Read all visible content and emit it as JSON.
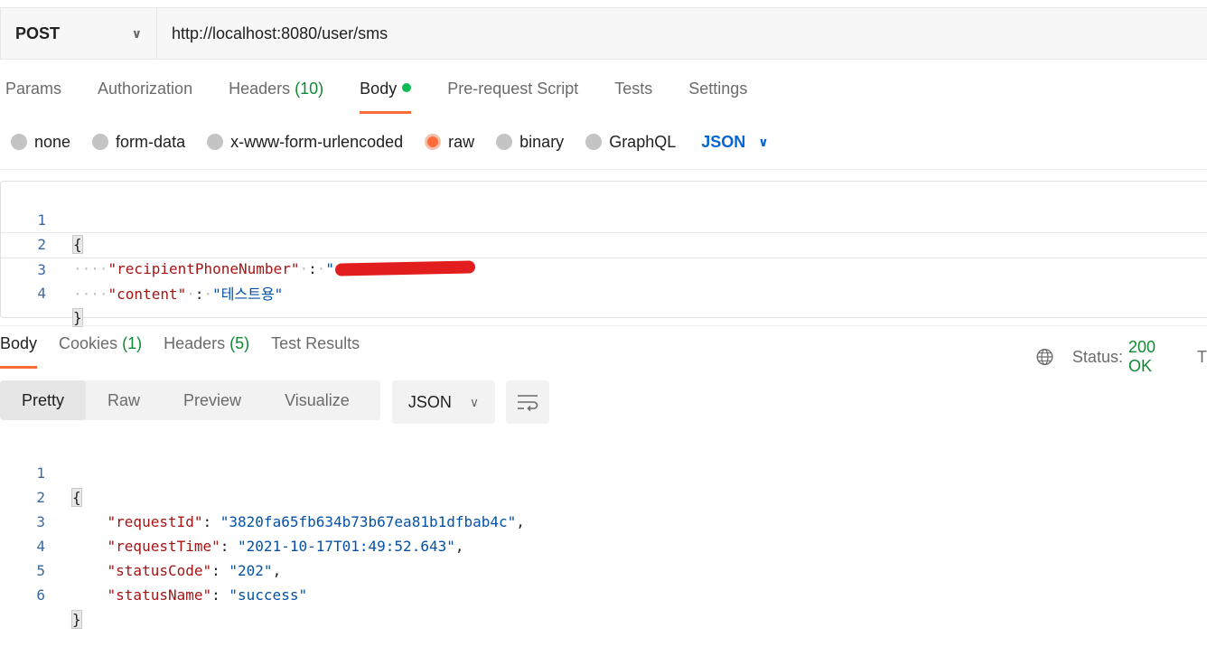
{
  "request": {
    "method": "POST",
    "url": "http://localhost:8080/user/sms"
  },
  "request_tabs": [
    {
      "label": "Params"
    },
    {
      "label": "Authorization"
    },
    {
      "label": "Headers",
      "count": "(10)"
    },
    {
      "label": "Body"
    },
    {
      "label": "Pre-request Script"
    },
    {
      "label": "Tests"
    },
    {
      "label": "Settings"
    }
  ],
  "body_types": [
    "none",
    "form-data",
    "x-www-form-urlencoded",
    "raw",
    "binary",
    "GraphQL"
  ],
  "body_format": "JSON",
  "request_body": {
    "line_numbers": [
      "1",
      "2",
      "3",
      "4"
    ],
    "open_brace": "{",
    "close_brace": "}",
    "key1": "\"recipientPhoneNumber\"",
    "key2": "\"content\"",
    "value2": "\"테스트용\"",
    "colon": ":"
  },
  "response_tabs": [
    {
      "label": "Body"
    },
    {
      "label": "Cookies",
      "count": "(1)"
    },
    {
      "label": "Headers",
      "count": "(5)"
    },
    {
      "label": "Test Results"
    }
  ],
  "status": {
    "label": "Status:",
    "value": "200 OK",
    "truncated": "T"
  },
  "view_modes": [
    "Pretty",
    "Raw",
    "Preview",
    "Visualize"
  ],
  "response_format": "JSON",
  "response_body": {
    "line_numbers": [
      "1",
      "2",
      "3",
      "4",
      "5",
      "6"
    ],
    "open_brace": "{",
    "close_brace": "}",
    "fields": [
      {
        "key": "\"requestId\"",
        "value": "\"3820fa65fb634b73b67ea81b1dfbab4c\"",
        "comma": ","
      },
      {
        "key": "\"requestTime\"",
        "value": "\"2021-10-17T01:49:52.643\"",
        "comma": ","
      },
      {
        "key": "\"statusCode\"",
        "value": "\"202\"",
        "comma": ","
      },
      {
        "key": "\"statusName\"",
        "value": "\"success\"",
        "comma": ""
      }
    ]
  },
  "colors": {
    "accent": "#ff6c37",
    "count_green": "#0f8a34",
    "json_blue": "#0265d2"
  }
}
